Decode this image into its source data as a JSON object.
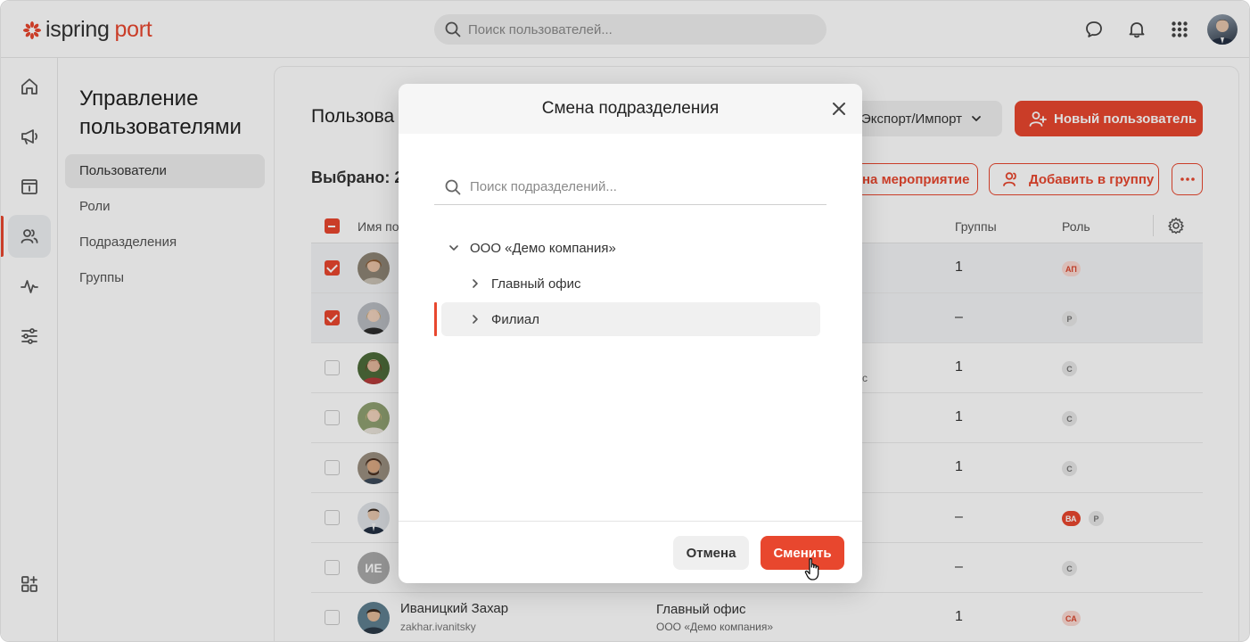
{
  "app": {
    "logo_part1": "ispring",
    "logo_part2": "port",
    "brand_color": "#e8472e"
  },
  "header": {
    "search_placeholder": "Поиск пользователей...",
    "icons": [
      "chat-icon",
      "bell-icon",
      "apps-grid-icon"
    ]
  },
  "rail": {
    "items": [
      "home-icon",
      "megaphone-icon",
      "calendar-icon",
      "users-icon",
      "activity-icon",
      "settings-sliders-icon",
      "add-widget-icon"
    ],
    "active": "users-icon"
  },
  "section": {
    "title": "Управление пользователями",
    "items": [
      {
        "label": "Пользователи",
        "active": true
      },
      {
        "label": "Роли",
        "active": false
      },
      {
        "label": "Подразделения",
        "active": false
      },
      {
        "label": "Группы",
        "active": false
      }
    ]
  },
  "main": {
    "title_visible": "Пользова",
    "export_label": "Экспорт/Импорт",
    "new_user_label": "Новый пользователь",
    "selected_visible": "Выбрано: 2",
    "event_button_visible": "на мероприятие",
    "add_group_label": "Добавить в группу",
    "columns": {
      "name_visible": "Имя по",
      "groups": "Группы",
      "role": "Роль"
    },
    "rows": [
      {
        "checked": true,
        "groups": "1",
        "roles": [
          "АП"
        ]
      },
      {
        "checked": true,
        "groups": "–",
        "roles": [
          "Р"
        ]
      },
      {
        "checked": false,
        "groups": "1",
        "roles": [
          "С"
        ],
        "sub_fragment": "с"
      },
      {
        "checked": false,
        "groups": "1",
        "roles": [
          "С"
        ]
      },
      {
        "checked": false,
        "groups": "1",
        "roles": [
          "С"
        ]
      },
      {
        "checked": false,
        "groups": "–",
        "roles": [
          "ВА",
          "Р"
        ]
      },
      {
        "checked": false,
        "groups": "–",
        "roles": [
          "С"
        ],
        "initials": "ИЕ"
      },
      {
        "checked": false,
        "groups": "1",
        "roles": [
          "СА"
        ],
        "name": "Иваницкий Захар",
        "login": "zakhar.ivanitsky",
        "dept": "Главный офис",
        "company": "ООО «Демо компания»"
      }
    ]
  },
  "modal": {
    "title": "Смена подразделения",
    "search_placeholder": "Поиск подразделений...",
    "tree": [
      {
        "label": "ООО «Демо компания»",
        "expanded": true,
        "level": 0
      },
      {
        "label": "Главный офис",
        "expanded": false,
        "level": 1
      },
      {
        "label": "Филиал",
        "expanded": false,
        "level": 1,
        "selected": true
      }
    ],
    "cancel_label": "Отмена",
    "apply_label": "Сменить"
  }
}
